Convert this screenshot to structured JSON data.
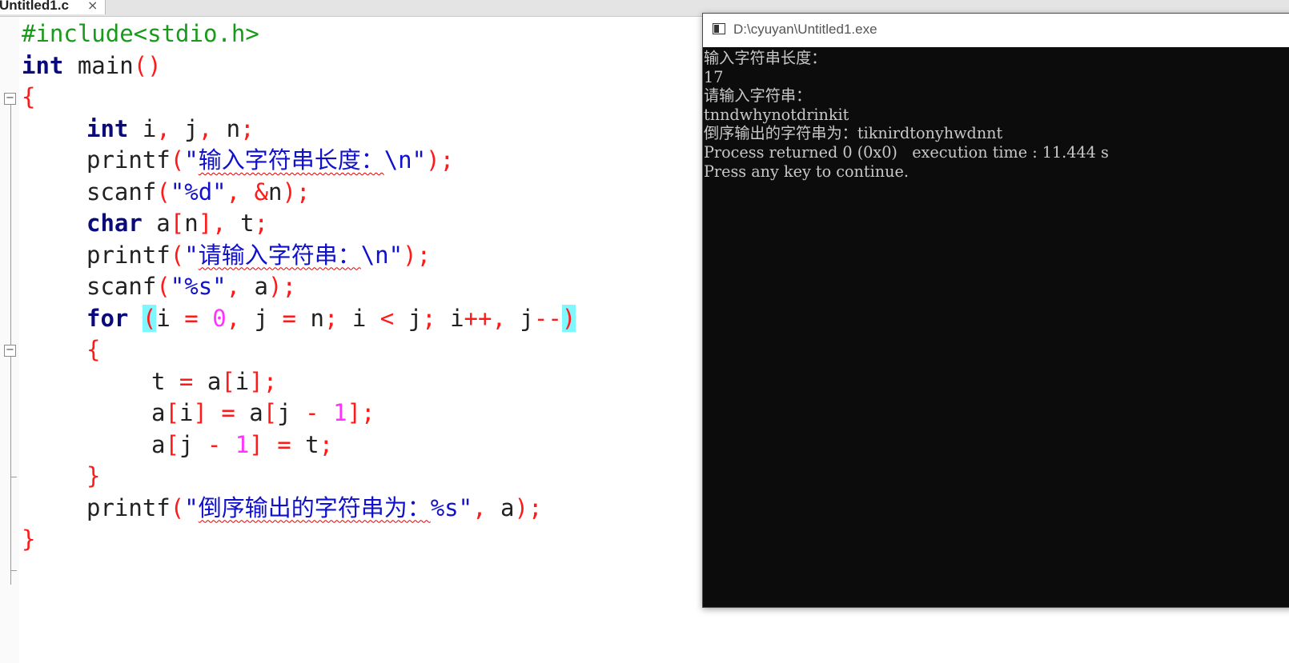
{
  "tab": {
    "title": "Untitled1.c",
    "close": "×"
  },
  "code_lines": [
    [
      {
        "t": "#include<stdio.h>",
        "c": "pp"
      }
    ],
    [
      {
        "t": "int",
        "c": "kw"
      },
      {
        "t": " main"
      },
      {
        "t": "()",
        "c": "op"
      }
    ],
    [
      {
        "t": "{",
        "c": "op"
      }
    ],
    [
      {
        "t": "int",
        "c": "kw"
      },
      {
        "t": " i"
      },
      {
        "t": ",",
        "c": "op"
      },
      {
        "t": " j"
      },
      {
        "t": ",",
        "c": "op"
      },
      {
        "t": " n"
      },
      {
        "t": ";",
        "c": "op"
      }
    ],
    [
      {
        "t": "printf"
      },
      {
        "t": "(",
        "c": "op"
      },
      {
        "t": "\"",
        "c": "str"
      },
      {
        "t": "输入字符串长度：",
        "c": "str sq"
      },
      {
        "t": "\\n\"",
        "c": "str"
      },
      {
        "t": ");",
        "c": "op"
      }
    ],
    [
      {
        "t": "scanf"
      },
      {
        "t": "(",
        "c": "op"
      },
      {
        "t": "\"%d\"",
        "c": "str"
      },
      {
        "t": ",",
        "c": "op"
      },
      {
        "t": " "
      },
      {
        "t": "&",
        "c": "op"
      },
      {
        "t": "n"
      },
      {
        "t": ");",
        "c": "op"
      }
    ],
    [
      {
        "t": "char",
        "c": "kw"
      },
      {
        "t": " a"
      },
      {
        "t": "[",
        "c": "op"
      },
      {
        "t": "n"
      },
      {
        "t": "],",
        "c": "op"
      },
      {
        "t": " t"
      },
      {
        "t": ";",
        "c": "op"
      }
    ],
    [
      {
        "t": "printf"
      },
      {
        "t": "(",
        "c": "op"
      },
      {
        "t": "\"",
        "c": "str"
      },
      {
        "t": "请输入字符串：",
        "c": "str sq"
      },
      {
        "t": "\\n\"",
        "c": "str"
      },
      {
        "t": ");",
        "c": "op"
      }
    ],
    [
      {
        "t": "scanf"
      },
      {
        "t": "(",
        "c": "op"
      },
      {
        "t": "\"%s\"",
        "c": "str"
      },
      {
        "t": ",",
        "c": "op"
      },
      {
        "t": " a"
      },
      {
        "t": ");",
        "c": "op"
      }
    ],
    [
      {
        "t": "for",
        "c": "kw"
      },
      {
        "t": " "
      },
      {
        "t": "(",
        "c": "op hl"
      },
      {
        "t": "i "
      },
      {
        "t": "=",
        "c": "op"
      },
      {
        "t": " "
      },
      {
        "t": "0",
        "c": "num"
      },
      {
        "t": ",",
        "c": "op"
      },
      {
        "t": " j "
      },
      {
        "t": "=",
        "c": "op"
      },
      {
        "t": " n"
      },
      {
        "t": ";",
        "c": "op"
      },
      {
        "t": " i "
      },
      {
        "t": "<",
        "c": "op"
      },
      {
        "t": " j"
      },
      {
        "t": ";",
        "c": "op"
      },
      {
        "t": " i"
      },
      {
        "t": "++,",
        "c": "op"
      },
      {
        "t": " j"
      },
      {
        "t": "--",
        "c": "op"
      },
      {
        "t": ")",
        "c": "op hl"
      }
    ],
    [
      {
        "t": "{",
        "c": "op"
      }
    ],
    [
      {
        "t": "t "
      },
      {
        "t": "=",
        "c": "op"
      },
      {
        "t": " a"
      },
      {
        "t": "[",
        "c": "op"
      },
      {
        "t": "i"
      },
      {
        "t": "];",
        "c": "op"
      }
    ],
    [
      {
        "t": "a"
      },
      {
        "t": "[",
        "c": "op"
      },
      {
        "t": "i"
      },
      {
        "t": "]",
        "c": "op"
      },
      {
        "t": " "
      },
      {
        "t": "=",
        "c": "op"
      },
      {
        "t": " a"
      },
      {
        "t": "[",
        "c": "op"
      },
      {
        "t": "j "
      },
      {
        "t": "-",
        "c": "op"
      },
      {
        "t": " "
      },
      {
        "t": "1",
        "c": "num"
      },
      {
        "t": "];",
        "c": "op"
      }
    ],
    [
      {
        "t": "a"
      },
      {
        "t": "[",
        "c": "op"
      },
      {
        "t": "j "
      },
      {
        "t": "-",
        "c": "op"
      },
      {
        "t": " "
      },
      {
        "t": "1",
        "c": "num"
      },
      {
        "t": "]",
        "c": "op"
      },
      {
        "t": " "
      },
      {
        "t": "=",
        "c": "op"
      },
      {
        "t": " t"
      },
      {
        "t": ";",
        "c": "op"
      }
    ],
    [
      {
        "t": "}",
        "c": "op"
      }
    ],
    [
      {
        "t": "printf"
      },
      {
        "t": "(",
        "c": "op"
      },
      {
        "t": "\"",
        "c": "str"
      },
      {
        "t": "倒序输出的字符串为：",
        "c": "str sq"
      },
      {
        "t": "%s\"",
        "c": "str"
      },
      {
        "t": ",",
        "c": "op"
      },
      {
        "t": " a"
      },
      {
        "t": ");",
        "c": "op"
      }
    ],
    [
      {
        "t": "}",
        "c": "op"
      }
    ]
  ],
  "console": {
    "title": "D:\\cyuyan\\Untitled1.exe",
    "lines": [
      "输入字符串长度：",
      "17",
      "请输入字符串：",
      "tnndwhynotdrinkit",
      "倒序输出的字符串为：tiknirdtonyhwdnnt",
      "Process returned 0 (0x0)   execution time : 11.444 s",
      "Press any key to continue."
    ]
  }
}
